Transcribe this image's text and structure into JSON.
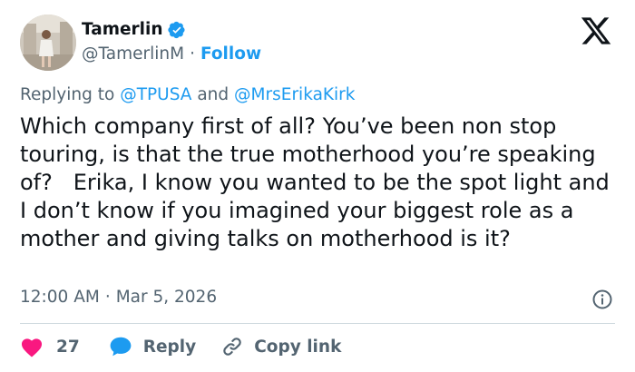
{
  "author": {
    "display_name": "Tamerlin",
    "handle": "@TamerlinM",
    "separator": "·",
    "follow_label": "Follow",
    "verified": true
  },
  "reply_context": {
    "prefix": "Replying to",
    "mention_1": "@TPUSA",
    "conjunction": "and",
    "mention_2": "@MrsErikaKirk"
  },
  "post": {
    "text": "Which company first of all? You’ve been non stop touring, is that the true motherhood you’re speaking of?   Erika, I know you wanted to be the spot light and I don’t know if you imagined your biggest role as a mother and giving talks on motherhood is it?",
    "time": "12:00 AM",
    "separator": "·",
    "date": "Mar 5, 2026"
  },
  "actions": {
    "like_count": "27",
    "reply_label": "Reply",
    "copy_link_label": "Copy link"
  },
  "colors": {
    "accent": "#1d9bf0",
    "like": "#f91880",
    "muted": "#536471",
    "text": "#0f1419"
  },
  "icons": [
    "verified-badge-icon",
    "x-logo-icon",
    "info-icon",
    "heart-icon",
    "reply-bubble-icon",
    "link-icon"
  ]
}
